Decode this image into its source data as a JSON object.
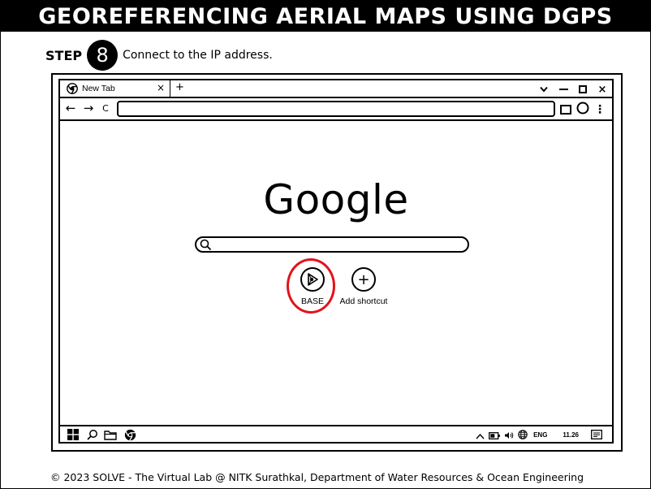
{
  "header": {
    "title": "GEOREFERENCING AERIAL MAPS USING DGPS"
  },
  "step": {
    "label": "STEP",
    "number": "8",
    "instruction": "Connect to the IP address."
  },
  "browser": {
    "tab": {
      "title": "New Tab",
      "close": "×"
    },
    "new_tab": "+",
    "window_controls": {
      "dropdown_icon": "chevron-down-icon",
      "minimize_icon": "minimize-icon",
      "maximize_icon": "maximize-icon",
      "close": "×"
    },
    "toolbar": {
      "back": "←",
      "forward": "→",
      "reload": "C",
      "menu": "⋮",
      "address_value": ""
    }
  },
  "newtab": {
    "logo": "Google",
    "search_value": "",
    "shortcuts": [
      {
        "label": "BASE",
        "icon": "base-play-icon"
      },
      {
        "label": "Add shortcut",
        "icon": "add-shortcut-icon",
        "symbol": "+"
      }
    ],
    "highlight_color": "#e3121b"
  },
  "taskbar": {
    "icons": [
      "windows-start-icon",
      "search-icon",
      "folder-icon",
      "chrome-icon"
    ],
    "tray": {
      "language": "ENG",
      "time": "11.26"
    }
  },
  "footer": {
    "text": "© 2023 SOLVE - The Virtual Lab @ NITK Surathkal, Department of Water Resources & Ocean Engineering"
  }
}
